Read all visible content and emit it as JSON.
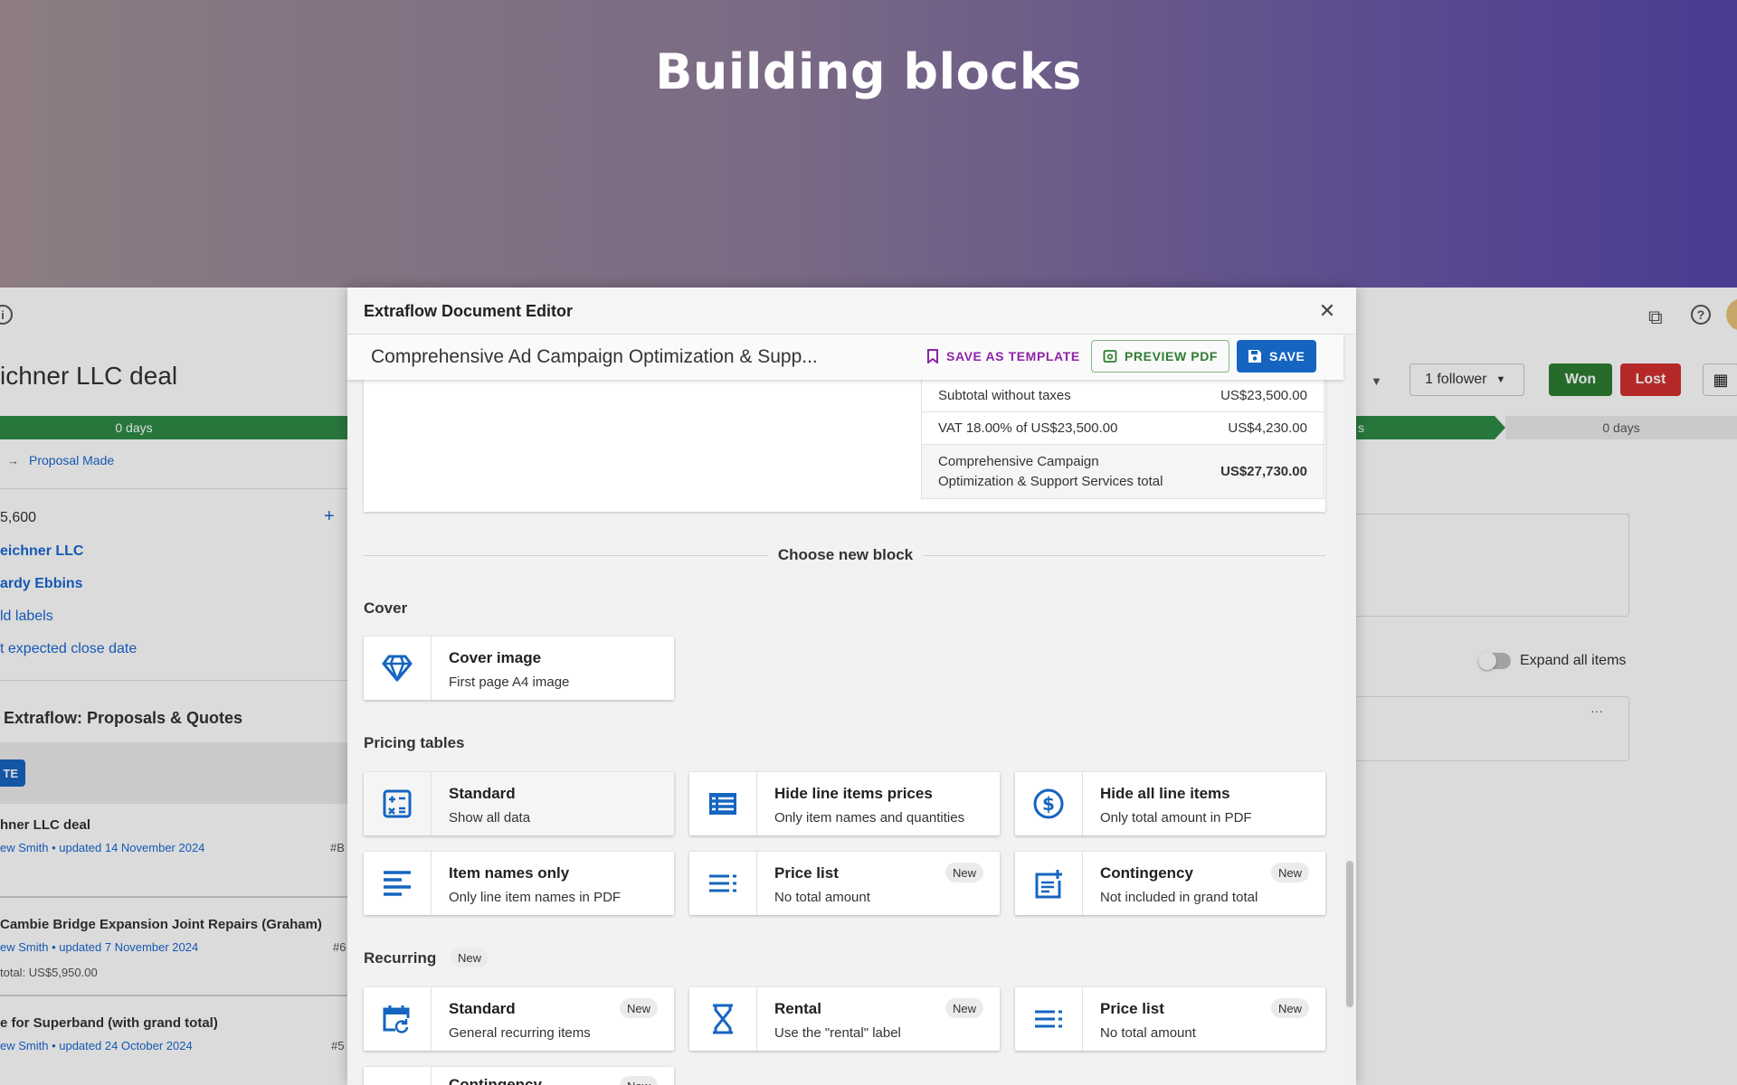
{
  "hero": {
    "title": "Building blocks"
  },
  "background": {
    "deal_title": "ichner LLC deal",
    "pipeline_days_left": "0 days",
    "pipeline_days_right": "0 days",
    "pipeline_right_fragment": "s",
    "stage": "Proposal Made",
    "value": "5,600",
    "org": "eichner LLC",
    "person": "ardy Ebbins",
    "labels": "ld labels",
    "close_date": "t expected close date",
    "extraflow_section": "Extraflow: Proposals & Quotes",
    "create_btn": "TE",
    "follower_btn": "1 follower",
    "won": "Won",
    "lost": "Lost",
    "expand_all": "Expand all items",
    "more": "···",
    "deals": [
      {
        "title": "hner LLC deal",
        "meta": "ew Smith • updated 14 November 2024",
        "id": "#B"
      },
      {
        "title": "Cambie Bridge Expansion Joint Repairs (Graham)",
        "meta": "ew Smith • updated 7 November 2024",
        "id": "#6",
        "extra": "total: US$5,950.00"
      },
      {
        "title": "e for Superband (with grand total)",
        "meta": "ew Smith • updated 24 October 2024",
        "id": "#5"
      }
    ],
    "colors": {
      "won": "#2e7d32",
      "lost": "#d32f2f",
      "pipeline": "#2e8b47"
    }
  },
  "editor": {
    "title": "Extraflow Document Editor",
    "doc_title": "Comprehensive Ad Campaign Optimization & Supp...",
    "save_template": "SAVE AS TEMPLATE",
    "preview_pdf": "PREVIEW PDF",
    "save": "SAVE",
    "totals": {
      "subtotal_label": "Subtotal without taxes",
      "subtotal_value": "US$23,500.00",
      "vat_label": "VAT 18.00% of US$23,500.00",
      "vat_value": "US$4,230.00",
      "total_label_1": "Comprehensive Campaign",
      "total_label_2": "Optimization & Support Services total",
      "total_value": "US$27,730.00"
    },
    "choose_block": "Choose new block",
    "cover": {
      "title": "Cover",
      "blocks": [
        {
          "name": "Cover image",
          "desc": "First page A4 image",
          "icon": "diamond-icon"
        }
      ]
    },
    "pricing": {
      "title": "Pricing tables",
      "blocks": [
        {
          "name": "Standard",
          "desc": "Show all data",
          "icon": "calculator-icon"
        },
        {
          "name": "Hide line items prices",
          "desc": "Only item names and quantities",
          "icon": "list-icon"
        },
        {
          "name": "Hide all line items",
          "desc": "Only total amount in PDF",
          "icon": "dollar-circle-icon"
        },
        {
          "name": "Item names only",
          "desc": "Only line item names in PDF",
          "icon": "align-left-icon"
        },
        {
          "name": "Price list",
          "desc": "No total amount",
          "icon": "price-list-icon",
          "badge": "New"
        },
        {
          "name": "Contingency",
          "desc": "Not included in grand total",
          "icon": "note-add-icon",
          "badge": "New"
        }
      ]
    },
    "recurring": {
      "title": "Recurring",
      "badge": "New",
      "blocks": [
        {
          "name": "Standard",
          "desc": "General recurring items",
          "icon": "calendar-repeat-icon",
          "badge": "New"
        },
        {
          "name": "Rental",
          "desc": "Use the \"rental\" label",
          "icon": "hourglass-icon",
          "badge": "New"
        },
        {
          "name": "Price list",
          "desc": "No total amount",
          "icon": "price-list-icon",
          "badge": "New"
        },
        {
          "name": "Contingency",
          "desc": "",
          "icon": "note-add-icon",
          "badge": "New"
        }
      ]
    },
    "colors": {
      "primary": "#1565c0",
      "template": "#8e24aa",
      "preview": "#2e7d32"
    }
  }
}
